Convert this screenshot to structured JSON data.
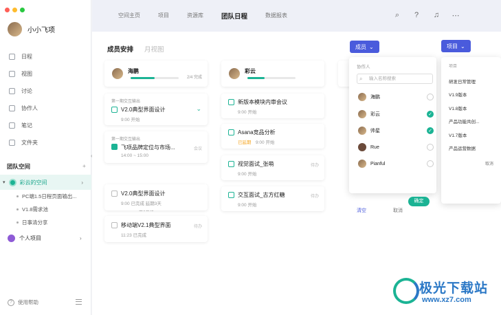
{
  "user": {
    "name": "小小飞项"
  },
  "nav": [
    {
      "label": "日程",
      "icon": "calendar-icon"
    },
    {
      "label": "视图",
      "icon": "view-icon"
    },
    {
      "label": "讨论",
      "icon": "discussion-icon"
    },
    {
      "label": "协作人",
      "icon": "collaborator-icon"
    },
    {
      "label": "笔记",
      "icon": "note-icon"
    },
    {
      "label": "文件夹",
      "icon": "folder-icon"
    }
  ],
  "team_space": {
    "title": "团队空间",
    "add": "+",
    "active_space": "彩云的空间"
  },
  "space_items": [
    "PC端1.5日程页面输出...",
    "V1.8需求池",
    "日事清分享"
  ],
  "personal": {
    "label": "个人项目"
  },
  "help": {
    "label": "使用帮助"
  },
  "top_tabs": [
    "空间主页",
    "项目",
    "资源库",
    "团队日程",
    "数据报表"
  ],
  "active_tab": "团队日程",
  "sub_tabs": {
    "members": "成员安排",
    "month": "月视图"
  },
  "buttons": {
    "members": "成员",
    "project": "项目"
  },
  "columns": [
    {
      "member": "海鹏",
      "progress_text": "2/4 完成",
      "progress": 0.5
    },
    {
      "member": "彩云",
      "progress": 0.35
    }
  ],
  "col1_tasks": [
    {
      "label": "第一期交互输出",
      "title": "V2.0典型界面设计",
      "meta": "9:00 开始"
    },
    {
      "label": "第一期交互输出",
      "title": "飞项品牌定位与市场...",
      "meta": "14:00 ~ 15:00",
      "tag": "会议"
    }
  ],
  "done_label": "已完成",
  "col1_done": [
    {
      "title": "V2.0典型界面设计",
      "meta": "9:00 已完成  延期3天"
    },
    {
      "title": "移动端V2.1典型界面",
      "meta": "11:23 已完成",
      "tag": "待办"
    }
  ],
  "col2_tasks": [
    {
      "title": "新版本模块内审会议",
      "meta": "9:00 开始"
    },
    {
      "title": "Asana竞品分析",
      "overdue": "已延期",
      "meta": "9:00 开始"
    },
    {
      "title": "视觉面试_张萌",
      "meta": "9:00 开始",
      "tag": "待办"
    },
    {
      "title": "交互面试_古方红糖",
      "meta": "9:00 开始",
      "tag": "待办"
    }
  ],
  "member_dropdown": {
    "header": "协作人",
    "search_placeholder": "输入名称搜索",
    "members": [
      {
        "name": "海鹏",
        "checked": false
      },
      {
        "name": "彩云",
        "checked": true
      },
      {
        "name": "帅星",
        "checked": true
      },
      {
        "name": "Rue",
        "checked": false
      },
      {
        "name": "Pianful",
        "checked": false
      }
    ],
    "clear": "清空",
    "cancel": "取消",
    "confirm": "确定"
  },
  "project_dropdown": {
    "header": "项目",
    "items": [
      "研发日常管理",
      "V1.9版本",
      "V1.8版本",
      "产品功能共创...",
      "V1.7版本",
      "产品运营数据"
    ],
    "cancel": "取消"
  },
  "watermark": {
    "text": "极光下载站",
    "url": "www.xz7.com"
  },
  "colors": {
    "accent": "#1bb394",
    "brand_blue": "#4a5bdc"
  }
}
